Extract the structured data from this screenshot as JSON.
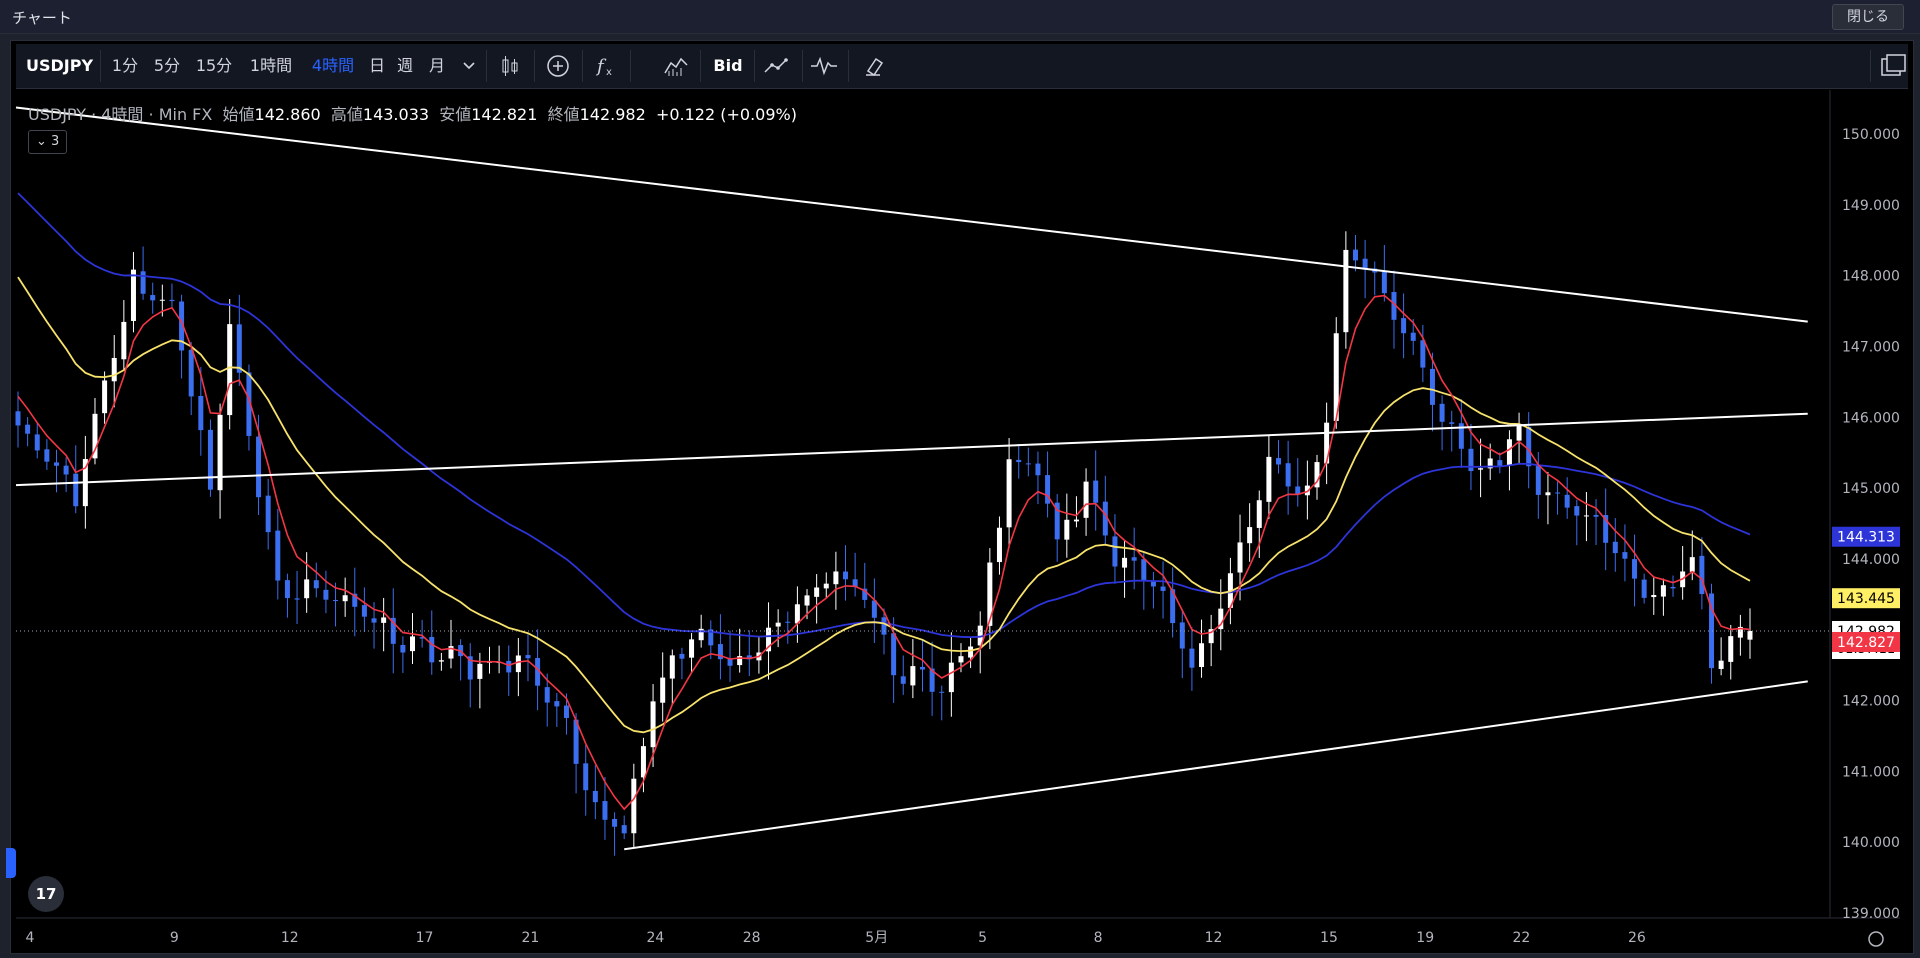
{
  "window": {
    "title": "チャート",
    "close_label": "閉じる"
  },
  "toolbar": {
    "symbol": "USDJPY",
    "intervals": [
      "1分",
      "5分",
      "15分",
      "1時間",
      "4時間",
      "日",
      "週",
      "月"
    ],
    "active_interval": "4時間",
    "price_type": "Bid",
    "icons": [
      "chevron-down-icon",
      "candle-style-icon",
      "add-compare-icon",
      "indicators-icon",
      "templates-icon",
      "bid-label",
      "alert-line-icon",
      "replay-icon",
      "clear-drawing-icon",
      "layout-icon"
    ]
  },
  "legend": {
    "symbol": "USDJPY",
    "interval": "4時間",
    "source": "Min FX",
    "open_label": "始値",
    "open": "142.860",
    "high_label": "高値",
    "high": "143.033",
    "low_label": "安値",
    "low": "142.821",
    "close_label": "終値",
    "close": "142.982",
    "change": "+0.122 (+0.09%)",
    "indicator_count": "3"
  },
  "chart_data": {
    "type": "candlestick",
    "y_range": [
      139.0,
      150.3
    ],
    "y_ticks": [
      "150.000",
      "149.000",
      "148.000",
      "147.000",
      "146.000",
      "145.000",
      "144.000",
      "143.000",
      "142.000",
      "141.000",
      "140.000",
      "139.000"
    ],
    "x_labels": [
      "4",
      "9",
      "12",
      "17",
      "21",
      "24",
      "28",
      "5月",
      "5",
      "8",
      "12",
      "15",
      "19",
      "22",
      "26"
    ],
    "price_badges": [
      {
        "value": "144.313",
        "color": "#2d34d8",
        "text": "#ffffff"
      },
      {
        "value": "143.445",
        "color": "#ffef64",
        "text": "#000000"
      },
      {
        "value": "142.982",
        "color": "#ffffff",
        "text": "#000000",
        "countdown": "01:57:11"
      },
      {
        "value": "142.827",
        "color": "#f23645",
        "text": "#ffffff"
      }
    ],
    "colors": {
      "up": "#ffffff",
      "down": "#3c6ef0",
      "ma_fast": "#f23645",
      "ma_mid": "#f7e26b",
      "ma_slow": "#2d34d8",
      "trendline": "#ffffff"
    },
    "anchors": [
      [
        0,
        145.85
      ],
      [
        6,
        144.9
      ],
      [
        12,
        147.9
      ],
      [
        16,
        147.6
      ],
      [
        20,
        145.0
      ],
      [
        22,
        147.3
      ],
      [
        27,
        143.5
      ],
      [
        32,
        143.6
      ],
      [
        40,
        142.8
      ],
      [
        47,
        142.5
      ],
      [
        53,
        142.55
      ],
      [
        57,
        141.6
      ],
      [
        60,
        140.5
      ],
      [
        63,
        140.2
      ],
      [
        66,
        142.1
      ],
      [
        70,
        142.9
      ],
      [
        75,
        142.5
      ],
      [
        80,
        143.2
      ],
      [
        85,
        143.8
      ],
      [
        88,
        143.5
      ],
      [
        91,
        142.4
      ],
      [
        96,
        142.2
      ],
      [
        100,
        143.0
      ],
      [
        103,
        145.4
      ],
      [
        106,
        145.3
      ],
      [
        108,
        144.2
      ],
      [
        111,
        145.0
      ],
      [
        114,
        144.1
      ],
      [
        118,
        143.6
      ],
      [
        122,
        142.5
      ],
      [
        126,
        143.7
      ],
      [
        130,
        145.3
      ],
      [
        134,
        144.9
      ],
      [
        136,
        146.0
      ],
      [
        138,
        148.3
      ],
      [
        140,
        148.2
      ],
      [
        144,
        147.3
      ],
      [
        148,
        145.9
      ],
      [
        152,
        145.2
      ],
      [
        156,
        145.8
      ],
      [
        158,
        145.0
      ],
      [
        162,
        144.8
      ],
      [
        166,
        144.1
      ],
      [
        170,
        143.4
      ],
      [
        174,
        144.0
      ],
      [
        176,
        142.6
      ],
      [
        180,
        142.98
      ]
    ],
    "trendlines": [
      {
        "from": [
          -8,
          150.5
        ],
        "to": [
          186,
          147.35
        ]
      },
      {
        "from": [
          -8,
          145.0
        ],
        "to": [
          186,
          146.05
        ]
      },
      {
        "from": [
          63,
          139.9
        ],
        "to": [
          186,
          142.27
        ]
      }
    ]
  }
}
